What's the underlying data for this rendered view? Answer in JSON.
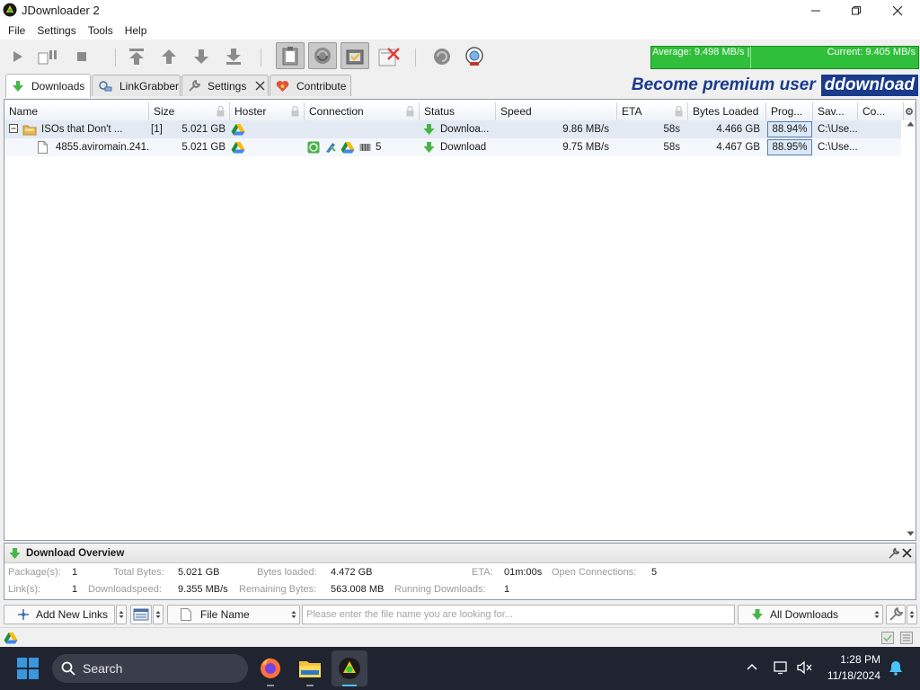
{
  "window": {
    "title": "JDownloader 2",
    "icon": "jdownloader-logo-icon"
  },
  "menu": [
    "File",
    "Settings",
    "Tools",
    "Help"
  ],
  "toolbar": {
    "buttons": [
      "play-icon",
      "pause-icon",
      "stop-icon",
      "move-top-icon",
      "move-up-icon",
      "move-down-icon",
      "move-bottom-icon",
      "clipboard-observer-icon",
      "reconnect-icon",
      "premium-toggle-icon",
      "shutdown-icon",
      "refresh-icon",
      "update-icon"
    ]
  },
  "speed": {
    "average": "Average: 9.498 MB/s |",
    "current": "Current: 9.405 MB/s"
  },
  "tabs": [
    {
      "label": "Downloads",
      "icon": "download-arrow-icon",
      "active": true
    },
    {
      "label": "LinkGrabber",
      "icon": "linkgrabber-icon",
      "active": false
    },
    {
      "label": "Settings",
      "icon": "wrench-icon",
      "active": false,
      "closable": true
    },
    {
      "label": "Contribute",
      "icon": "heart-icon",
      "active": false
    }
  ],
  "banner": {
    "text": "Become premium user",
    "logo": "ddownload"
  },
  "table": {
    "columns": [
      "Name",
      "Size",
      "Hoster",
      "Connection",
      "Status",
      "Speed",
      "ETA",
      "Bytes Loaded",
      "Prog...",
      "Sav...",
      "Co..."
    ],
    "package": {
      "expander": "⊟",
      "name": "ISOs that Don't ...",
      "count": "[1]",
      "size": "5.021 GB",
      "status": "Downloa...",
      "speed": "9.86 MB/s",
      "eta": "58s",
      "bytes_loaded": "4.466 GB",
      "progress": "88.94%",
      "save_to": "C:\\Use..."
    },
    "links": [
      {
        "name": "4855.aviromain.241...",
        "size": "5.021 GB",
        "connections": "5",
        "status": "Download",
        "speed": "9.75 MB/s",
        "eta": "58s",
        "bytes_loaded": "4.467 GB",
        "progress": "88.95%",
        "save_to": "C:\\Use..."
      }
    ]
  },
  "overview": {
    "title": "Download Overview",
    "labels": {
      "packages": "Package(s):",
      "total_bytes": "Total Bytes:",
      "bytes_loaded": "Bytes loaded:",
      "eta": "ETA:",
      "open_connections": "Open Connections:",
      "links": "Link(s):",
      "downloadspeed": "Downloadspeed:",
      "remaining_bytes": "Remaining Bytes:",
      "running_downloads": "Running Downloads:"
    },
    "values": {
      "packages": "1",
      "total_bytes": "5.021 GB",
      "bytes_loaded": "4.472 GB",
      "eta": "01m:00s",
      "open_connections": "5",
      "links": "1",
      "downloadspeed": "9.355 MB/s",
      "remaining_bytes": "563.008 MB",
      "running_downloads": "1"
    }
  },
  "bottom": {
    "add_links": "Add New Links",
    "search_column": "File Name",
    "search_placeholder": "Please enter the file name you are looking for...",
    "filter": "All Downloads"
  },
  "taskbar": {
    "search_label": "Search",
    "time": "1:28 PM",
    "date": "11/18/2024"
  },
  "colors": {
    "speed_green": "#2fbf3b",
    "premium_blue": "#1a3b8c",
    "progress_fill": "#dbe8f7"
  }
}
